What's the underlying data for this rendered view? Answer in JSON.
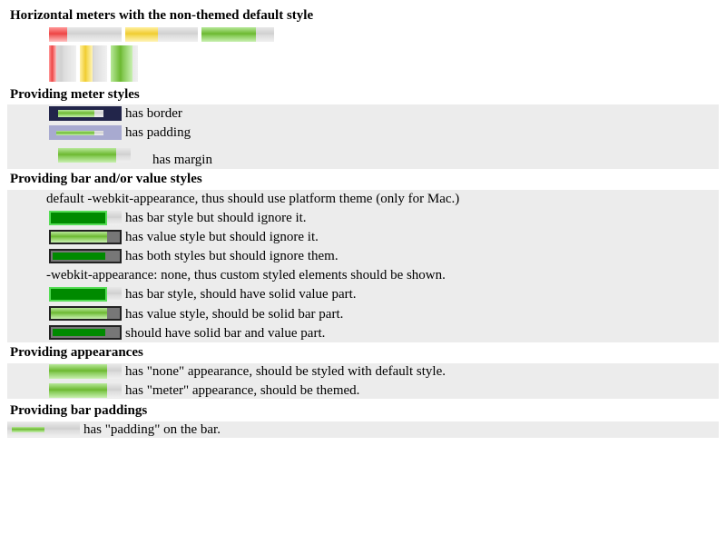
{
  "sections": {
    "default_style": "Horizontal meters with the non-themed default style",
    "meter_styles": "Providing meter styles",
    "bar_value_styles": "Providing bar and/or value styles",
    "appearances": "Providing appearances",
    "bar_paddings": "Providing bar paddings"
  },
  "meter_styles": {
    "border": "has border",
    "padding": "has padding",
    "margin": "has margin"
  },
  "bar_value": {
    "default_note": "default -webkit-appearance, thus should use platform theme (only for Mac.)",
    "bar_ignore": "has bar style but should ignore it.",
    "value_ignore": "has value style but should ignore it.",
    "both_ignore": "has both styles but should ignore them.",
    "none_note": "-webkit-appearance: none, thus custom styled elements should be shown.",
    "bar_solid": "has bar style, should have solid value part.",
    "value_solid": "has value style, should be solid bar part.",
    "both_solid": "should have solid bar and value part."
  },
  "appearances": {
    "none": "has \"none\" appearance, should be styled with default style.",
    "meter": "has \"meter\" appearance, should be themed."
  },
  "bar_paddings": {
    "padding": "has \"padding\" on the bar."
  },
  "meters": {
    "horizontal": [
      {
        "level": "low",
        "color": "#ee4444",
        "fraction": 0.25
      },
      {
        "level": "medium",
        "color": "#f0cc30",
        "fraction": 0.45
      },
      {
        "level": "high",
        "color": "#6cb830",
        "fraction": 0.75
      }
    ],
    "vertical": [
      {
        "level": "low",
        "color": "#ee4444",
        "fraction": 0.25
      },
      {
        "level": "medium",
        "color": "#f0cc30",
        "fraction": 0.45
      },
      {
        "level": "high",
        "color": "#6cb830",
        "fraction": 0.75
      }
    ],
    "bordered_fraction": 0.75,
    "padded_fraction": 0.75,
    "margin_fraction": 0.8,
    "styled_fraction": 0.8,
    "appearance_fraction": 0.8,
    "bar_padding_fraction": 0.55
  },
  "colors": {
    "band": "#ececec",
    "border_meter_bg": "#22254a",
    "padding_meter_bg": "#a8aad0",
    "solid_value": "#008a00",
    "solid_bar": "#777777"
  }
}
